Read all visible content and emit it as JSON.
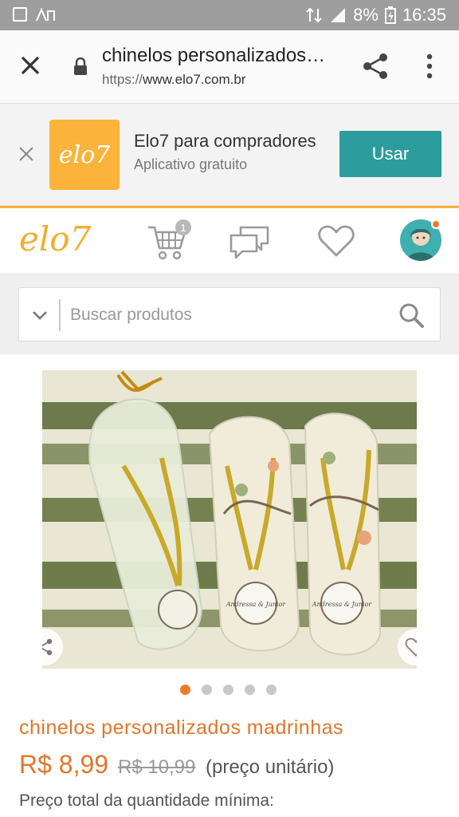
{
  "status_bar": {
    "battery": "8%",
    "time": "16:35"
  },
  "browser": {
    "page_title": "chinelos personalizados madrinhas",
    "url_scheme": "https://",
    "url_host": "www.elo7.com.br"
  },
  "app_banner": {
    "logo_text": "elo7",
    "app_name": "Elo7 para compradores",
    "app_subtitle": "Aplicativo gratuito",
    "install_button": "Usar"
  },
  "site_header": {
    "brand": "elo7",
    "cart_count": "1"
  },
  "search": {
    "placeholder": "Buscar produtos"
  },
  "gallery": {
    "image_count": 5,
    "active_index": 0,
    "signature_text": "Andressa & Junior"
  },
  "product": {
    "title": "chinelos personalizados madrinhas",
    "price": "R$ 8,99",
    "old_price": "R$ 10,99",
    "unit_note": "(preço unitário)",
    "total_note": "Preço total da quantidade mínima:"
  },
  "colors": {
    "brand_orange": "#e0762b",
    "brand_yellow": "#fbb33b",
    "install_teal": "#2c9c9c"
  }
}
